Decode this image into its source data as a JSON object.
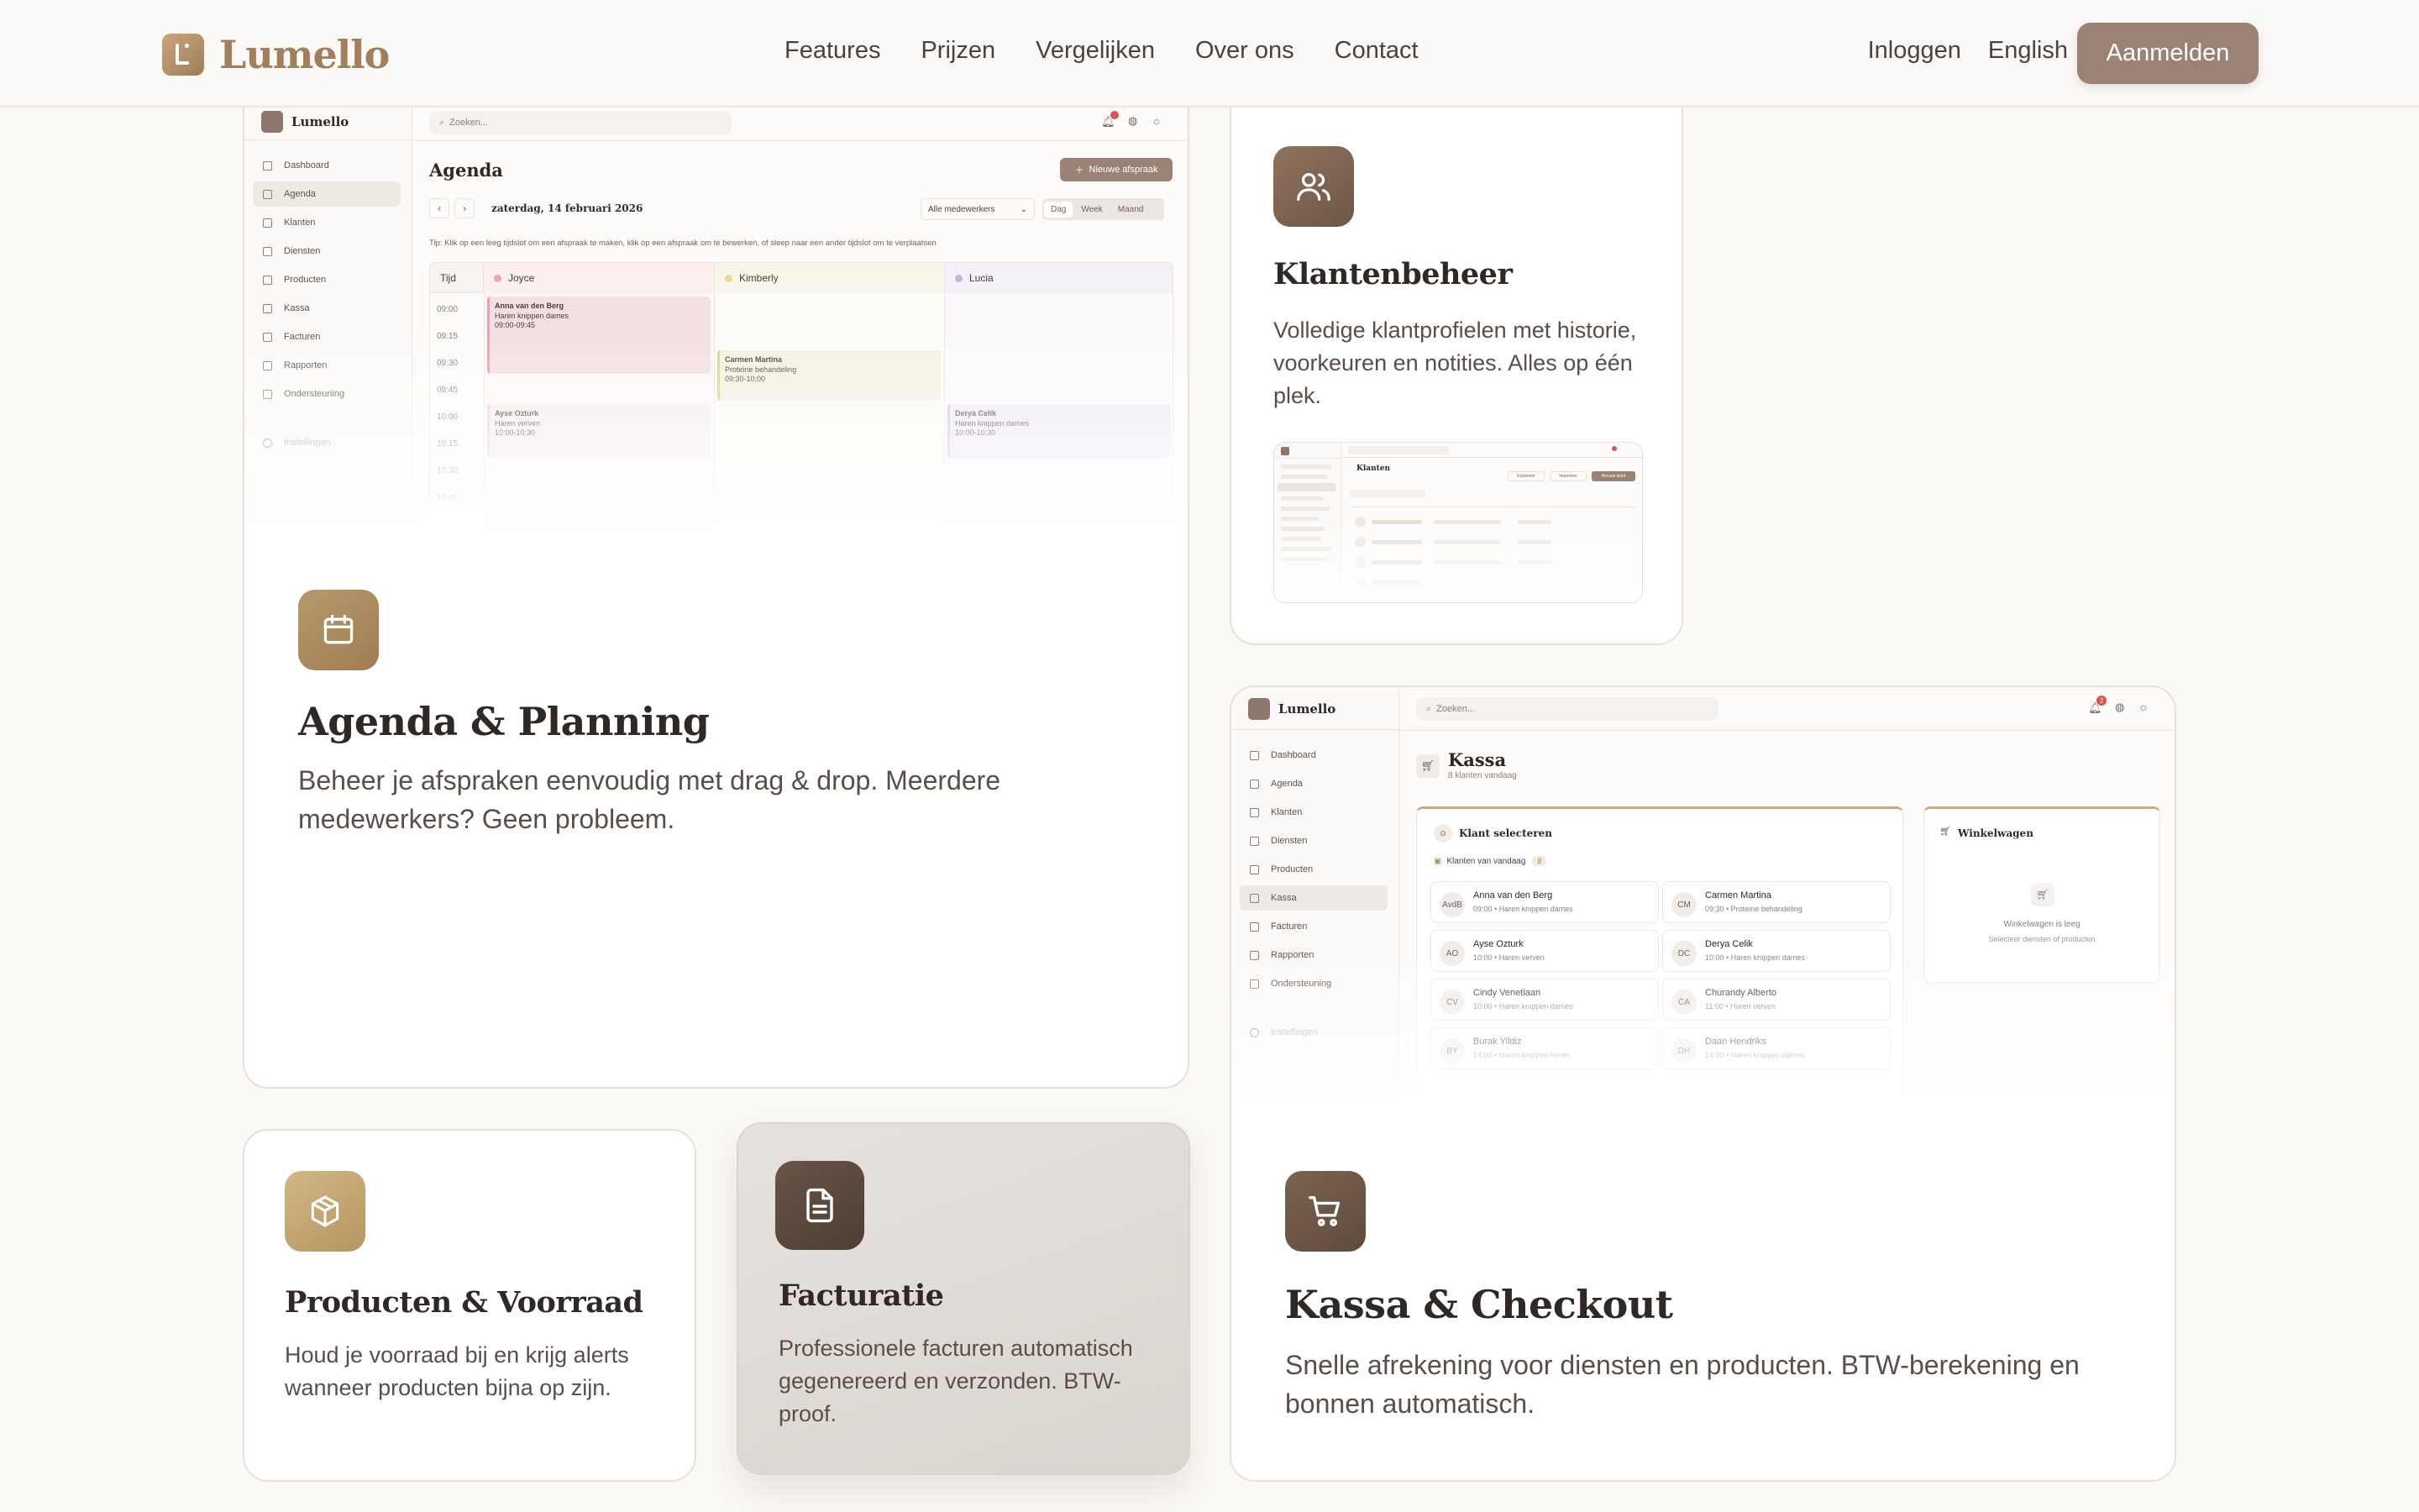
{
  "header": {
    "brand": "Lumello",
    "nav": [
      "Features",
      "Prijzen",
      "Vergelijken",
      "Over ons",
      "Contact"
    ],
    "login": "Inloggen",
    "language": "English",
    "cta": "Aanmelden"
  },
  "colors": {
    "accent": "#9c8175",
    "brand": "#a27e5a",
    "gold": "#b59365",
    "dark": "#6e5747"
  },
  "cards": {
    "agenda": {
      "title": "Agenda & Planning",
      "desc": "Beheer je afspraken eenvoudig met drag & drop. Meerdere medewerkers? Geen probleem.",
      "icon": "calendar-icon"
    },
    "clients": {
      "title": "Klantenbeheer",
      "desc": "Volledige klantprofielen met historie, voorkeuren en notities. Alles op één plek.",
      "icon": "users-icon"
    },
    "checkout": {
      "title": "Kassa & Checkout",
      "desc": "Snelle afrekening voor diensten en producten. BTW-berekening en bonnen automatisch.",
      "icon": "cart-icon"
    },
    "products": {
      "title": "Producten & Voorraad",
      "desc": "Houd je voorraad bij en krijg alerts wanneer producten bijna op zijn.",
      "icon": "box-icon"
    },
    "invoices": {
      "title": "Facturatie",
      "desc": "Professionele facturen automatisch gegenereerd en verzonden. BTW-proof.",
      "icon": "document-icon"
    }
  },
  "app": {
    "brand": "Lumello",
    "search": "Zoeken...",
    "sidebar": [
      "Dashboard",
      "Agenda",
      "Klanten",
      "Diensten",
      "Producten",
      "Kassa",
      "Facturen",
      "Rapporten",
      "Ondersteuning"
    ],
    "settings": "Instellingen",
    "agenda": {
      "title": "Agenda",
      "new_button": "Nieuwe afspraak",
      "date": "zaterdag, 14 februari 2026",
      "staff_filter": "Alle medewerkers",
      "views": [
        "Dag",
        "Week",
        "Maand"
      ],
      "tip": "Tip: Klik op een leeg tijdslot om een afspraak te maken, klik op een afspraak om te bewerken, of sleep naar een ander tijdslot om te verplaatsen",
      "time_header": "Tijd",
      "staff": [
        "Joyce",
        "Kimberly",
        "Lucia"
      ],
      "times": [
        "09:00",
        "09:15",
        "09:30",
        "09:45",
        "10:00",
        "10:15",
        "10:30",
        "10:45"
      ],
      "appointments": [
        {
          "name": "Anna van den Berg",
          "service": "Haren knippen dames",
          "time": "09:00-09:45"
        },
        {
          "name": "Carmen Martina",
          "service": "Proteine behandeling",
          "time": "09:30-10:00"
        },
        {
          "name": "Ayse Ozturk",
          "service": "Haren verven",
          "time": "10:00-10:30"
        },
        {
          "name": "Derya Celik",
          "service": "Haren knippen dames",
          "time": "10:00-10:30"
        }
      ]
    },
    "clients": {
      "title": "Klanten",
      "btn1": "Exporteer",
      "btn2": "Importeer",
      "btn3": "Nieuwe klant"
    },
    "checkout": {
      "title": "Kassa",
      "subtitle": "8 klanten vandaag",
      "select_client": "Klant selecteren",
      "today_label": "Klanten van vandaag",
      "today_count": "8",
      "cart_title": "Winkelwagen",
      "cart_empty": "Winkelwagen is leeg",
      "cart_hint": "Selecteer diensten of producten",
      "notification_count": "3",
      "clients": [
        {
          "initials": "AvdB",
          "name": "Anna van den Berg",
          "info": "09:00 • Haren knippen dames"
        },
        {
          "initials": "CM",
          "name": "Carmen Martina",
          "info": "09:30 • Proteine behandeling"
        },
        {
          "initials": "AO",
          "name": "Ayse Ozturk",
          "info": "10:00 • Haren verven"
        },
        {
          "initials": "DC",
          "name": "Derya Celik",
          "info": "10:00 • Haren knippen dames"
        },
        {
          "initials": "CV",
          "name": "Cindy Venetiaan",
          "info": "10:00 • Haren knippen dames"
        },
        {
          "initials": "CA",
          "name": "Churandy Alberto",
          "info": "11:00 • Haren verven"
        },
        {
          "initials": "BY",
          "name": "Burak Yildiz",
          "info": "14:00 • Haren knippen heren"
        },
        {
          "initials": "DH",
          "name": "Daan Hendriks",
          "info": "14:00 • Haren knippen dames"
        }
      ]
    }
  }
}
